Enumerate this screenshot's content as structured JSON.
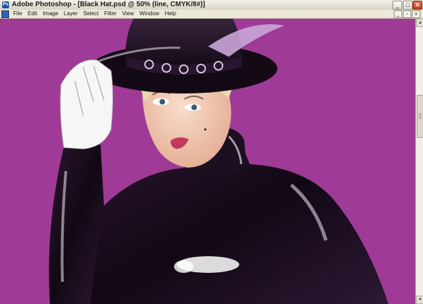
{
  "window": {
    "title": "Adobe Photoshop - [Black Hat.psd @ 50% (line, CMYK/8#)]",
    "app_icon_label": "Ps",
    "buttons": {
      "minimize": "_",
      "maximize": "□",
      "close": "✕"
    }
  },
  "menu": {
    "items": [
      "File",
      "Edit",
      "Image",
      "Layer",
      "Select",
      "Filter",
      "View",
      "Window",
      "Help"
    ],
    "doc_buttons": {
      "minimize": "_",
      "restore": "▫",
      "close": "x"
    }
  },
  "scrollbar": {
    "up_arrow": "▲",
    "down_arrow": "▼"
  },
  "canvas": {
    "background": "#9f3a96",
    "artwork": "woman-in-black-vinyl-outfit-and-hat-illustration"
  },
  "colors": {
    "canvas_purple": "#9f3a96",
    "vinyl_black": "#1a0e1e",
    "skin": "#f1cbb6",
    "lips": "#c23a5e",
    "glove": "#f6f6f6",
    "feather": "#c9a6d8"
  }
}
